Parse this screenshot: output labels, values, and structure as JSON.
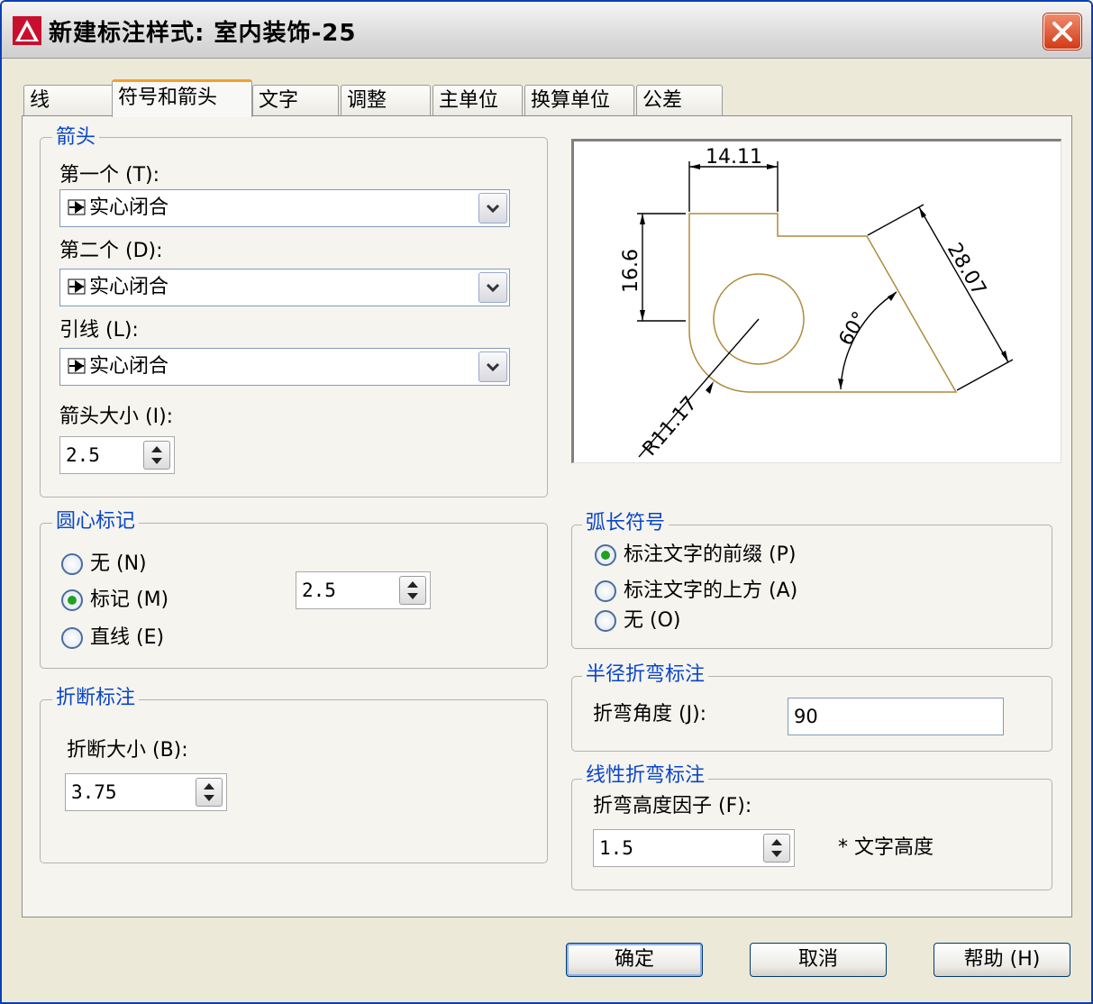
{
  "window": {
    "title": "新建标注样式: 室内装饰-25"
  },
  "tabs": [
    {
      "label": "线"
    },
    {
      "label": "符号和箭头"
    },
    {
      "label": "文字"
    },
    {
      "label": "调整"
    },
    {
      "label": "主单位"
    },
    {
      "label": "换算单位"
    },
    {
      "label": "公差"
    }
  ],
  "arrowheads": {
    "legend": "箭头",
    "first_label": "第一个 (T):",
    "first_value": "实心闭合",
    "second_label": "第二个 (D):",
    "second_value": "实心闭合",
    "leader_label": "引线 (L):",
    "leader_value": "实心闭合",
    "size_label": "箭头大小 (I):",
    "size_value": "2.5"
  },
  "center_marks": {
    "legend": "圆心标记",
    "options": [
      {
        "label": "无 (N)",
        "selected": false
      },
      {
        "label": "标记 (M)",
        "selected": true
      },
      {
        "label": "直线 (E)",
        "selected": false
      }
    ],
    "size_value": "2.5"
  },
  "dim_break": {
    "legend": "折断标注",
    "size_label": "折断大小 (B):",
    "size_value": "3.75"
  },
  "arc_length": {
    "legend": "弧长符号",
    "options": [
      {
        "label": "标注文字的前缀 (P)",
        "selected": true
      },
      {
        "label": "标注文字的上方 (A)",
        "selected": false
      },
      {
        "label": "无 (O)",
        "selected": false
      }
    ]
  },
  "radius_jog": {
    "legend": "半径折弯标注",
    "angle_label": "折弯角度 (J):",
    "angle_value": "90"
  },
  "linear_jog": {
    "legend": "线性折弯标注",
    "factor_label": "折弯高度因子 (F):",
    "factor_value": "1.5",
    "suffix": "* 文字高度"
  },
  "preview": {
    "dim_top": "14.11",
    "dim_left": "16.6",
    "dim_slant": "28.07",
    "dim_angle": "60°",
    "dim_radius": "R11.17"
  },
  "buttons": {
    "ok": "确定",
    "cancel": "取消",
    "help": "帮助 (H)"
  },
  "colors": {
    "title_bar_border": "#0a3fb5",
    "legend_text": "#0a46c8",
    "tab_active_accent": "#f0a030",
    "preview_geometry": "#b08a3a",
    "close_button": "#d23a18"
  }
}
